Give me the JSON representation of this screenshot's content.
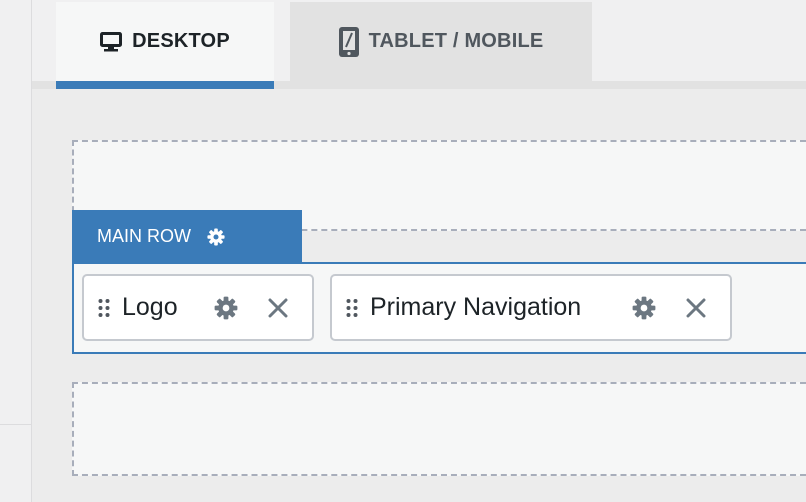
{
  "tabs": {
    "desktop": {
      "label": "DESKTOP",
      "icon": "desktop-icon",
      "active": true
    },
    "tablet": {
      "label": "TABLET / MOBILE",
      "icon": "tablet-icon",
      "active": false
    }
  },
  "main_row": {
    "label": "MAIN ROW",
    "icon": "gear-icon"
  },
  "items": [
    {
      "label": "Logo",
      "handle_icon": "drag-handle-icon",
      "settings_icon": "gear-icon",
      "remove_icon": "close-icon"
    },
    {
      "label": "Primary Navigation",
      "handle_icon": "drag-handle-icon",
      "settings_icon": "gear-icon",
      "remove_icon": "close-icon"
    }
  ],
  "colors": {
    "accent": "#3a7bb8",
    "active_tab_bg": "#f6f7f7",
    "inactive_tab_bg": "#e2e2e2",
    "icon_gray": "#6c7781",
    "zone_border": "#a8aebb"
  }
}
